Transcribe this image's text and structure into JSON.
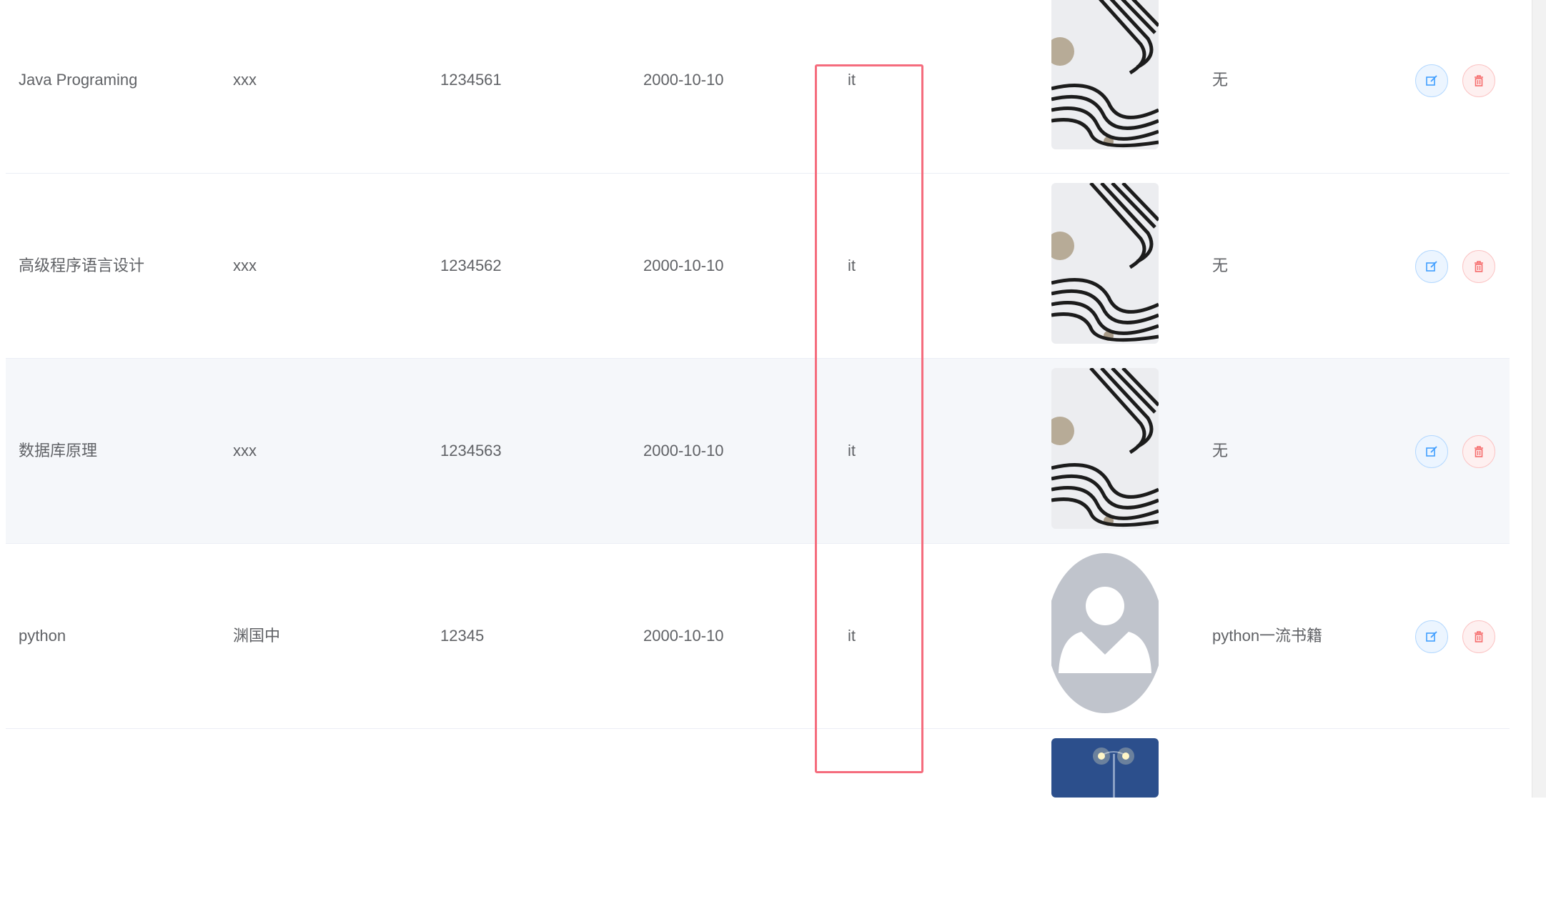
{
  "table": {
    "rows": [
      {
        "name": "Java Programing",
        "author": "xxx",
        "isbn": "1234561",
        "date": "2000-10-10",
        "category": "it",
        "cover": "abstract-ribbon",
        "note": "无"
      },
      {
        "name": "高级程序语言设计",
        "author": "xxx",
        "isbn": "1234562",
        "date": "2000-10-10",
        "category": "it",
        "cover": "abstract-ribbon",
        "note": "无"
      },
      {
        "name": "数据库原理",
        "author": "xxx",
        "isbn": "1234563",
        "date": "2000-10-10",
        "category": "it",
        "cover": "abstract-ribbon",
        "note": "无"
      },
      {
        "name": "python",
        "author": "渊国中",
        "isbn": "12345",
        "date": "2000-10-10",
        "category": "it",
        "cover": "default-avatar",
        "note": "python一流书籍"
      },
      {
        "name": "",
        "author": "",
        "isbn": "",
        "date": "",
        "category": "",
        "cover": "night-street-lamp",
        "note": ""
      }
    ],
    "hover_row": 2,
    "actions": {
      "edit_icon": "edit-icon",
      "delete_icon": "trash-icon"
    }
  },
  "colors": {
    "highlight": "#f56c7d",
    "edit": "#409eff",
    "delete": "#f56c6c",
    "hover_row": "#f5f7fa"
  }
}
